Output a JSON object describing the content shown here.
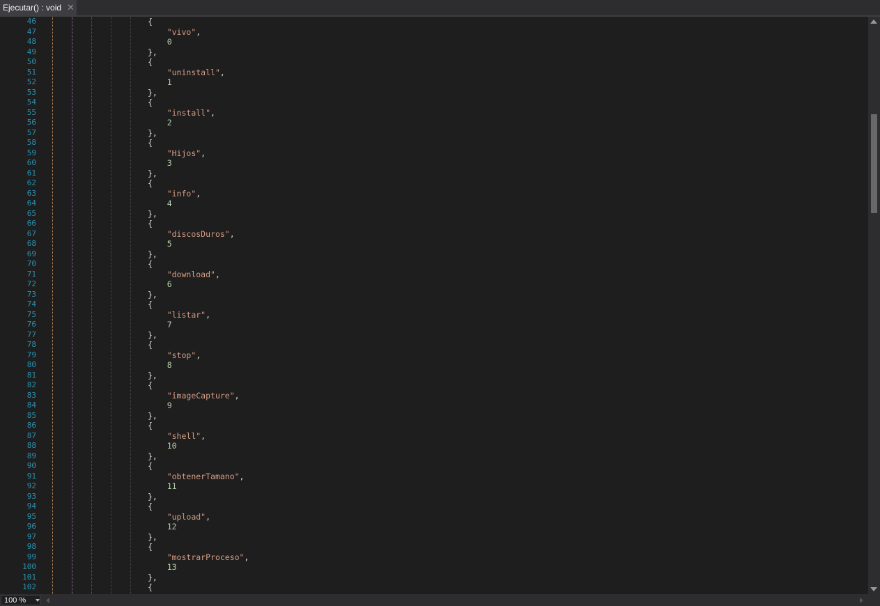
{
  "tab": {
    "title": "Ejecutar() : void",
    "close_glyph": "✕"
  },
  "status": {
    "zoom": "100 %"
  },
  "colors": {
    "line_number": "#2b91af",
    "string": "#d69d85",
    "number": "#b5cea8",
    "punctuation": "#dcdcdc",
    "background": "#1e1e1e"
  },
  "indent_guides": [
    {
      "color": "#c98d5b"
    },
    {
      "color": "#b065c7"
    },
    {
      "color": "#3f6b4a"
    },
    {
      "color": "#4a4a4a"
    }
  ],
  "lines": [
    {
      "n": "46",
      "code": [
        {
          "t": "{",
          "k": "p"
        }
      ]
    },
    {
      "n": "47",
      "code": [
        {
          "t": "    ",
          "k": "p"
        },
        {
          "t": "\"vivo\"",
          "k": "s"
        },
        {
          "t": ",",
          "k": "p"
        }
      ]
    },
    {
      "n": "48",
      "code": [
        {
          "t": "    ",
          "k": "p"
        },
        {
          "t": "0",
          "k": "n"
        }
      ]
    },
    {
      "n": "49",
      "code": [
        {
          "t": "},",
          "k": "p"
        }
      ]
    },
    {
      "n": "50",
      "code": [
        {
          "t": "{",
          "k": "p"
        }
      ]
    },
    {
      "n": "51",
      "code": [
        {
          "t": "    ",
          "k": "p"
        },
        {
          "t": "\"uninstall\"",
          "k": "s"
        },
        {
          "t": ",",
          "k": "p"
        }
      ]
    },
    {
      "n": "52",
      "code": [
        {
          "t": "    ",
          "k": "p"
        },
        {
          "t": "1",
          "k": "n"
        }
      ]
    },
    {
      "n": "53",
      "code": [
        {
          "t": "},",
          "k": "p"
        }
      ]
    },
    {
      "n": "54",
      "code": [
        {
          "t": "{",
          "k": "p"
        }
      ]
    },
    {
      "n": "55",
      "code": [
        {
          "t": "    ",
          "k": "p"
        },
        {
          "t": "\"install\"",
          "k": "s"
        },
        {
          "t": ",",
          "k": "p"
        }
      ]
    },
    {
      "n": "56",
      "code": [
        {
          "t": "    ",
          "k": "p"
        },
        {
          "t": "2",
          "k": "n"
        }
      ]
    },
    {
      "n": "57",
      "code": [
        {
          "t": "},",
          "k": "p"
        }
      ]
    },
    {
      "n": "58",
      "code": [
        {
          "t": "{",
          "k": "p"
        }
      ]
    },
    {
      "n": "59",
      "code": [
        {
          "t": "    ",
          "k": "p"
        },
        {
          "t": "\"Hijos\"",
          "k": "s"
        },
        {
          "t": ",",
          "k": "p"
        }
      ]
    },
    {
      "n": "60",
      "code": [
        {
          "t": "    ",
          "k": "p"
        },
        {
          "t": "3",
          "k": "n"
        }
      ]
    },
    {
      "n": "61",
      "code": [
        {
          "t": "},",
          "k": "p"
        }
      ]
    },
    {
      "n": "62",
      "code": [
        {
          "t": "{",
          "k": "p"
        }
      ]
    },
    {
      "n": "63",
      "code": [
        {
          "t": "    ",
          "k": "p"
        },
        {
          "t": "\"info\"",
          "k": "s"
        },
        {
          "t": ",",
          "k": "p"
        }
      ]
    },
    {
      "n": "64",
      "code": [
        {
          "t": "    ",
          "k": "p"
        },
        {
          "t": "4",
          "k": "n"
        }
      ]
    },
    {
      "n": "65",
      "code": [
        {
          "t": "},",
          "k": "p"
        }
      ]
    },
    {
      "n": "66",
      "code": [
        {
          "t": "{",
          "k": "p"
        }
      ]
    },
    {
      "n": "67",
      "code": [
        {
          "t": "    ",
          "k": "p"
        },
        {
          "t": "\"discosDuros\"",
          "k": "s"
        },
        {
          "t": ",",
          "k": "p"
        }
      ]
    },
    {
      "n": "68",
      "code": [
        {
          "t": "    ",
          "k": "p"
        },
        {
          "t": "5",
          "k": "n"
        }
      ]
    },
    {
      "n": "69",
      "code": [
        {
          "t": "},",
          "k": "p"
        }
      ]
    },
    {
      "n": "70",
      "code": [
        {
          "t": "{",
          "k": "p"
        }
      ]
    },
    {
      "n": "71",
      "code": [
        {
          "t": "    ",
          "k": "p"
        },
        {
          "t": "\"download\"",
          "k": "s"
        },
        {
          "t": ",",
          "k": "p"
        }
      ]
    },
    {
      "n": "72",
      "code": [
        {
          "t": "    ",
          "k": "p"
        },
        {
          "t": "6",
          "k": "n"
        }
      ]
    },
    {
      "n": "73",
      "code": [
        {
          "t": "},",
          "k": "p"
        }
      ]
    },
    {
      "n": "74",
      "code": [
        {
          "t": "{",
          "k": "p"
        }
      ]
    },
    {
      "n": "75",
      "code": [
        {
          "t": "    ",
          "k": "p"
        },
        {
          "t": "\"listar\"",
          "k": "s"
        },
        {
          "t": ",",
          "k": "p"
        }
      ]
    },
    {
      "n": "76",
      "code": [
        {
          "t": "    ",
          "k": "p"
        },
        {
          "t": "7",
          "k": "n"
        }
      ]
    },
    {
      "n": "77",
      "code": [
        {
          "t": "},",
          "k": "p"
        }
      ]
    },
    {
      "n": "78",
      "code": [
        {
          "t": "{",
          "k": "p"
        }
      ]
    },
    {
      "n": "79",
      "code": [
        {
          "t": "    ",
          "k": "p"
        },
        {
          "t": "\"stop\"",
          "k": "s"
        },
        {
          "t": ",",
          "k": "p"
        }
      ]
    },
    {
      "n": "80",
      "code": [
        {
          "t": "    ",
          "k": "p"
        },
        {
          "t": "8",
          "k": "n"
        }
      ]
    },
    {
      "n": "81",
      "code": [
        {
          "t": "},",
          "k": "p"
        }
      ]
    },
    {
      "n": "82",
      "code": [
        {
          "t": "{",
          "k": "p"
        }
      ]
    },
    {
      "n": "83",
      "code": [
        {
          "t": "    ",
          "k": "p"
        },
        {
          "t": "\"imageCapture\"",
          "k": "s"
        },
        {
          "t": ",",
          "k": "p"
        }
      ]
    },
    {
      "n": "84",
      "code": [
        {
          "t": "    ",
          "k": "p"
        },
        {
          "t": "9",
          "k": "n"
        }
      ]
    },
    {
      "n": "85",
      "code": [
        {
          "t": "},",
          "k": "p"
        }
      ]
    },
    {
      "n": "86",
      "code": [
        {
          "t": "{",
          "k": "p"
        }
      ]
    },
    {
      "n": "87",
      "code": [
        {
          "t": "    ",
          "k": "p"
        },
        {
          "t": "\"shell\"",
          "k": "s"
        },
        {
          "t": ",",
          "k": "p"
        }
      ]
    },
    {
      "n": "88",
      "code": [
        {
          "t": "    ",
          "k": "p"
        },
        {
          "t": "10",
          "k": "n"
        }
      ]
    },
    {
      "n": "89",
      "code": [
        {
          "t": "},",
          "k": "p"
        }
      ]
    },
    {
      "n": "90",
      "code": [
        {
          "t": "{",
          "k": "p"
        }
      ]
    },
    {
      "n": "91",
      "code": [
        {
          "t": "    ",
          "k": "p"
        },
        {
          "t": "\"obtenerTamano\"",
          "k": "s"
        },
        {
          "t": ",",
          "k": "p"
        }
      ]
    },
    {
      "n": "92",
      "code": [
        {
          "t": "    ",
          "k": "p"
        },
        {
          "t": "11",
          "k": "n"
        }
      ]
    },
    {
      "n": "93",
      "code": [
        {
          "t": "},",
          "k": "p"
        }
      ]
    },
    {
      "n": "94",
      "code": [
        {
          "t": "{",
          "k": "p"
        }
      ]
    },
    {
      "n": "95",
      "code": [
        {
          "t": "    ",
          "k": "p"
        },
        {
          "t": "\"upload\"",
          "k": "s"
        },
        {
          "t": ",",
          "k": "p"
        }
      ]
    },
    {
      "n": "96",
      "code": [
        {
          "t": "    ",
          "k": "p"
        },
        {
          "t": "12",
          "k": "n"
        }
      ]
    },
    {
      "n": "97",
      "code": [
        {
          "t": "},",
          "k": "p"
        }
      ]
    },
    {
      "n": "98",
      "code": [
        {
          "t": "{",
          "k": "p"
        }
      ]
    },
    {
      "n": "99",
      "code": [
        {
          "t": "    ",
          "k": "p"
        },
        {
          "t": "\"mostrarProceso\"",
          "k": "s"
        },
        {
          "t": ",",
          "k": "p"
        }
      ]
    },
    {
      "n": "100",
      "code": [
        {
          "t": "    ",
          "k": "p"
        },
        {
          "t": "13",
          "k": "n"
        }
      ]
    },
    {
      "n": "101",
      "code": [
        {
          "t": "},",
          "k": "p"
        }
      ]
    },
    {
      "n": "102",
      "code": [
        {
          "t": "{",
          "k": "p"
        }
      ]
    }
  ]
}
